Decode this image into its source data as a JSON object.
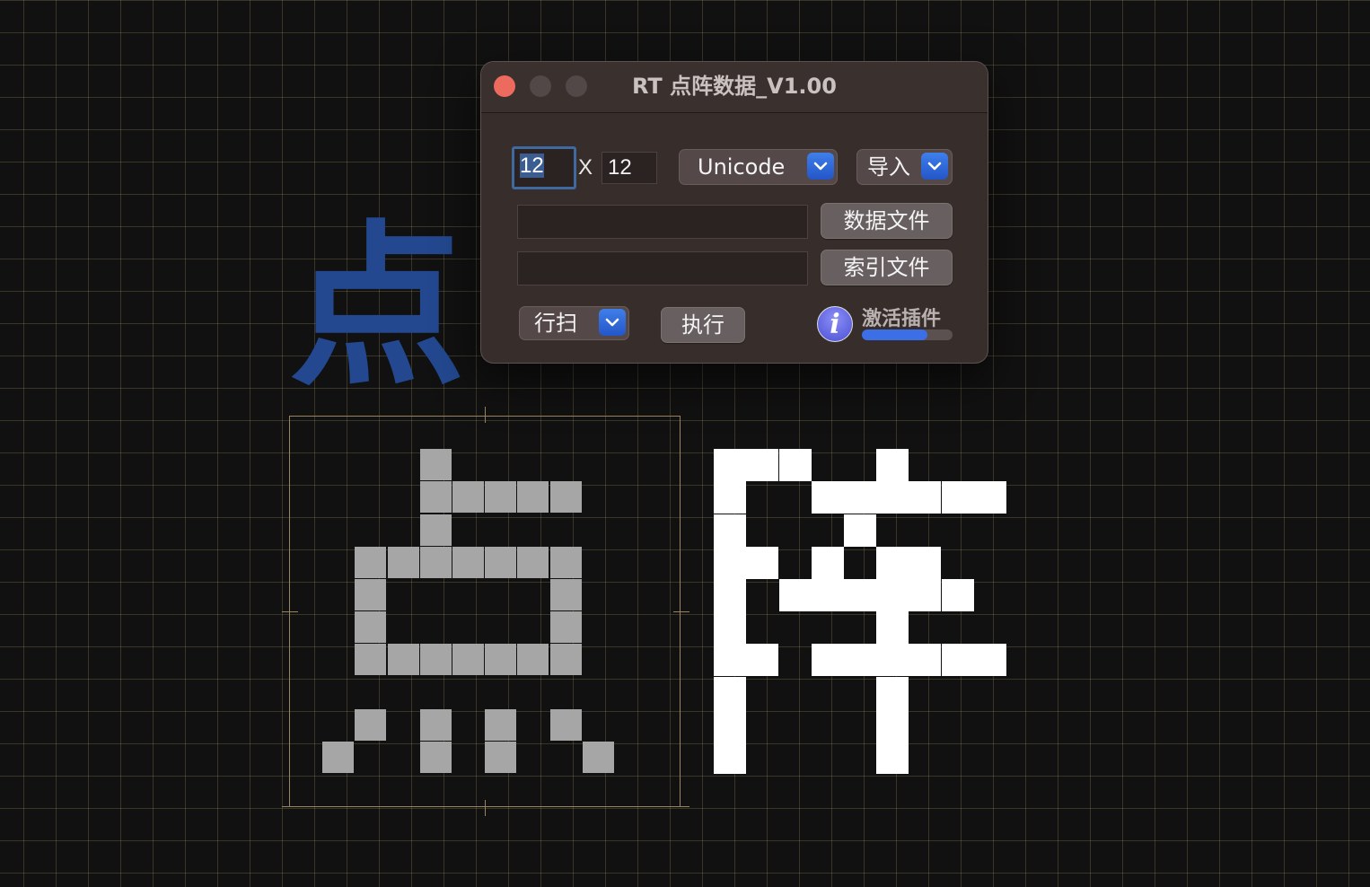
{
  "window": {
    "title": "RT 点阵数据_V1.00"
  },
  "size": {
    "width_value": "12",
    "separator": "X",
    "height_value": "12"
  },
  "encoding_popup": {
    "selected": "Unicode"
  },
  "import_popup": {
    "selected": "导入"
  },
  "data_file": {
    "path": "",
    "button_label": "数据文件"
  },
  "index_file": {
    "path": "",
    "button_label": "索引文件"
  },
  "scan_popup": {
    "selected": "行扫"
  },
  "execute_button": {
    "label": "执行"
  },
  "info_icon": {
    "glyph": "i"
  },
  "activate": {
    "label": "激活插件",
    "progress_fraction": 0.72
  },
  "canvas": {
    "preview_character": "点",
    "preview_color": "#23488f",
    "char_1": "点",
    "char_2": "阵",
    "grid_size": 12,
    "char_1_bitmap": [
      "000000000000",
      "000010000000",
      "000011111000",
      "000010000000",
      "001111111000",
      "001000001000",
      "001000001000",
      "001111111000",
      "000000000000",
      "001010101000",
      "010010100100",
      "000000000000"
    ],
    "char_2_bitmap": [
      "000000000000",
      "011100100000",
      "010011111100",
      "010001000000",
      "011010110000",
      "010111111000",
      "010000100000",
      "011011111100",
      "010000100000",
      "010000100000",
      "010000100000",
      "000000000000"
    ],
    "colors": {
      "char_1": "#a6a6a6",
      "char_2": "#ffffff",
      "background": "#111111"
    }
  }
}
